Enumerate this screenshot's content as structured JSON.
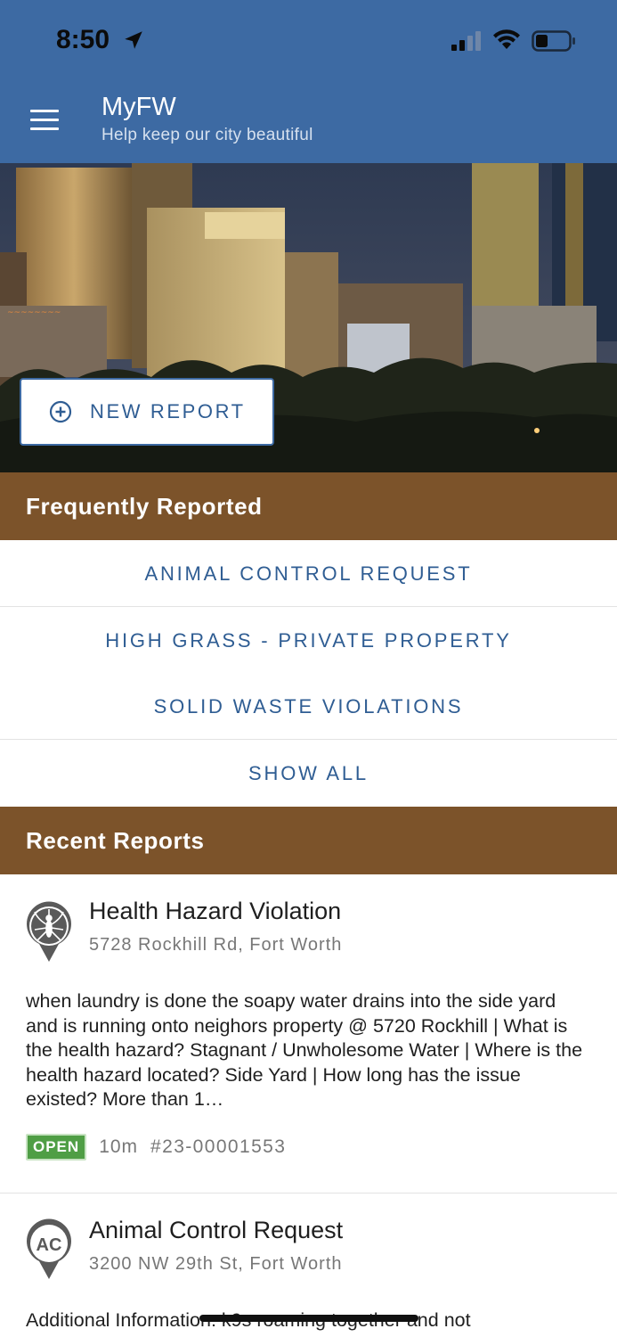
{
  "status_bar": {
    "time": "8:50"
  },
  "app_bar": {
    "title": "MyFW",
    "subtitle": "Help keep our city beautiful"
  },
  "hero": {
    "new_report_label": "NEW REPORT"
  },
  "frequently_reported": {
    "header": "Frequently Reported",
    "items": [
      "ANIMAL CONTROL REQUEST",
      "HIGH GRASS - PRIVATE PROPERTY",
      "SOLID WASTE VIOLATIONS",
      "SHOW ALL"
    ]
  },
  "recent_reports": {
    "header": "Recent Reports",
    "items": [
      {
        "title": "Health Hazard Violation",
        "address": "5728 Rockhill Rd, Fort Worth",
        "description": "when laundry is done the soapy water drains into the side yard and is running onto neighors property @ 5720 Rockhill | What is the health hazard? Stagnant / Unwholesome Water | Where is the health hazard located? Side Yard | How long has the issue existed? More than 1…",
        "status": "OPEN",
        "age": "10m",
        "number": "#23-00001553",
        "icon": "mosquito-pin-icon"
      },
      {
        "title": "Animal Control Request",
        "address": "3200 NW 29th St, Fort Worth",
        "description": "Additional Information: k9s roaming together  and not",
        "icon_text": "AC",
        "icon": "animal-control-pin-icon"
      }
    ]
  },
  "colors": {
    "app_bar": "#3d6aa3",
    "section_header": "#7c532a",
    "link_text": "#2f5d93",
    "open_badge": "#4f9e45"
  }
}
